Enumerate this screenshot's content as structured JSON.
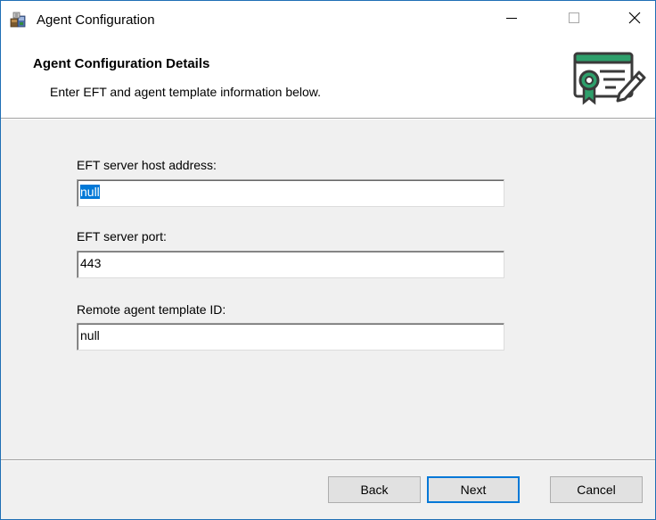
{
  "window": {
    "title": "Agent Configuration",
    "icon": "installer-package-icon"
  },
  "caption_buttons": {
    "minimize_icon": "minimize-icon",
    "maximize_icon": "maximize-icon",
    "close_icon": "close-icon"
  },
  "banner": {
    "title": "Agent Configuration Details",
    "subtitle": "Enter EFT and agent template information below.",
    "icon": "certificate-icon"
  },
  "form": {
    "fields": [
      {
        "label": "EFT server host address:",
        "value": "null",
        "selected": true
      },
      {
        "label": "EFT server port:",
        "value": "443",
        "selected": false
      },
      {
        "label": "Remote agent template ID:",
        "value": "null",
        "selected": false
      }
    ]
  },
  "buttons": {
    "back": "Back",
    "next": "Next",
    "cancel": "Cancel"
  },
  "colors": {
    "accent": "#0078d7",
    "window_border": "#1f6fb5",
    "certificate_green": "#2e9f6b",
    "dialog_background": "#f0f0f0"
  }
}
